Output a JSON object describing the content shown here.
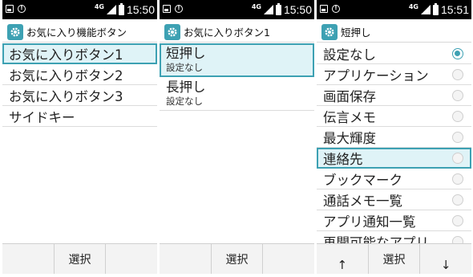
{
  "status": {
    "network": "4G"
  },
  "screens": [
    {
      "time": "15:50",
      "title": "お気に入り機能ボタン",
      "items": [
        "お気に入りボタン1",
        "お気に入りボタン2",
        "お気に入りボタン3",
        "サイドキー"
      ],
      "softkey_center": "選択"
    },
    {
      "time": "15:50",
      "title": "お気に入りボタン1",
      "items": [
        {
          "label": "短押し",
          "value": "設定なし"
        },
        {
          "label": "長押し",
          "value": "設定なし"
        }
      ],
      "softkey_center": "選択"
    },
    {
      "time": "15:51",
      "title": "短押し",
      "options": [
        "設定なし",
        "アプリケーション",
        "画面保存",
        "伝言メモ",
        "最大輝度",
        "連絡先",
        "ブックマーク",
        "通話メモ一覧",
        "アプリ通知一覧",
        "再開可能なアプリ"
      ],
      "checked_index": 0,
      "softkey_left": "↑",
      "softkey_center": "選択",
      "softkey_right": "↓"
    }
  ],
  "icons": {
    "settings": "gear-icon",
    "status_image": "image-notification-icon",
    "status_alert": "alert-icon"
  },
  "colors": {
    "accent": "#3da1b3",
    "highlight": "#dff3f7"
  }
}
